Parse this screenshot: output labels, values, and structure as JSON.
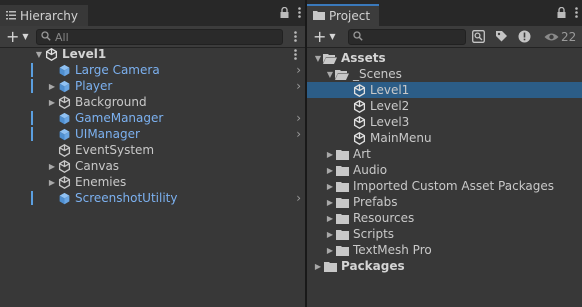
{
  "hierarchy": {
    "tab_title": "Hierarchy",
    "add_label": "+",
    "search_placeholder": "All",
    "scene_name": "Level1",
    "items": [
      {
        "label": "Large Camera",
        "prefab": true,
        "expandable": false,
        "has_arrow": true
      },
      {
        "label": "Player",
        "prefab": true,
        "expandable": true,
        "has_arrow": true
      },
      {
        "label": "Background",
        "prefab": false,
        "expandable": true,
        "has_arrow": false
      },
      {
        "label": "GameManager",
        "prefab": true,
        "expandable": false,
        "has_arrow": true
      },
      {
        "label": "UIManager",
        "prefab": true,
        "expandable": false,
        "has_arrow": true
      },
      {
        "label": "EventSystem",
        "prefab": false,
        "expandable": false,
        "has_arrow": false
      },
      {
        "label": "Canvas",
        "prefab": false,
        "expandable": true,
        "has_arrow": false
      },
      {
        "label": "Enemies",
        "prefab": false,
        "expandable": true,
        "has_arrow": false
      },
      {
        "label": "ScreenshotUtility",
        "prefab": true,
        "expandable": false,
        "has_arrow": true
      }
    ]
  },
  "project": {
    "tab_title": "Project",
    "add_label": "+",
    "search_placeholder": "",
    "hidden_count": "22",
    "assets_label": "Assets",
    "scenes_label": "_Scenes",
    "scenes": [
      "Level1",
      "Level2",
      "Level3",
      "MainMenu"
    ],
    "selected_scene": "Level1",
    "folders": [
      "Art",
      "Audio",
      "Imported Custom Asset Packages",
      "Prefabs",
      "Resources",
      "Scripts",
      "TextMesh Pro"
    ],
    "packages_label": "Packages"
  },
  "colors": {
    "selection": "#2c5d87",
    "prefab_text": "#7cb1f0",
    "panel_bg": "#383838"
  }
}
